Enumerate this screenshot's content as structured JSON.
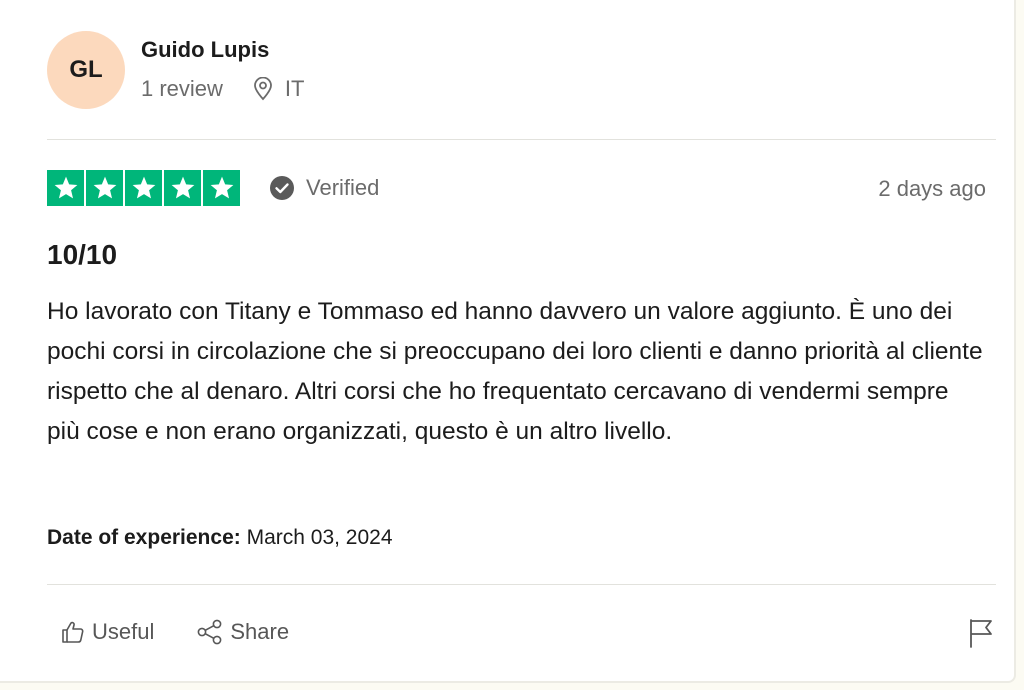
{
  "reviewer": {
    "initials": "GL",
    "name": "Guido Lupis",
    "review_count": "1 review",
    "country": "IT"
  },
  "rating": {
    "stars": 5,
    "max_stars": 5,
    "verified_label": "Verified",
    "posted_ago": "2 days ago"
  },
  "review": {
    "title": "10/10",
    "body": "Ho lavorato con Titany e Tommaso ed hanno davvero un valore aggiunto. È uno dei pochi corsi in circolazione che si preoccupano dei loro clienti e danno priorità al cliente rispetto che al denaro. Altri corsi che ho frequentato cercavano di vendermi sempre più cose e non erano organizzati, questo è un altro livello.",
    "experience_label": "Date of experience:",
    "experience_date": "March 03, 2024"
  },
  "actions": {
    "useful_label": "Useful",
    "share_label": "Share",
    "flag_icon": "flag-icon"
  },
  "colors": {
    "star_green": "#00b67a",
    "avatar_bg": "#fcd9bd",
    "muted_text": "#6b6b6b"
  }
}
